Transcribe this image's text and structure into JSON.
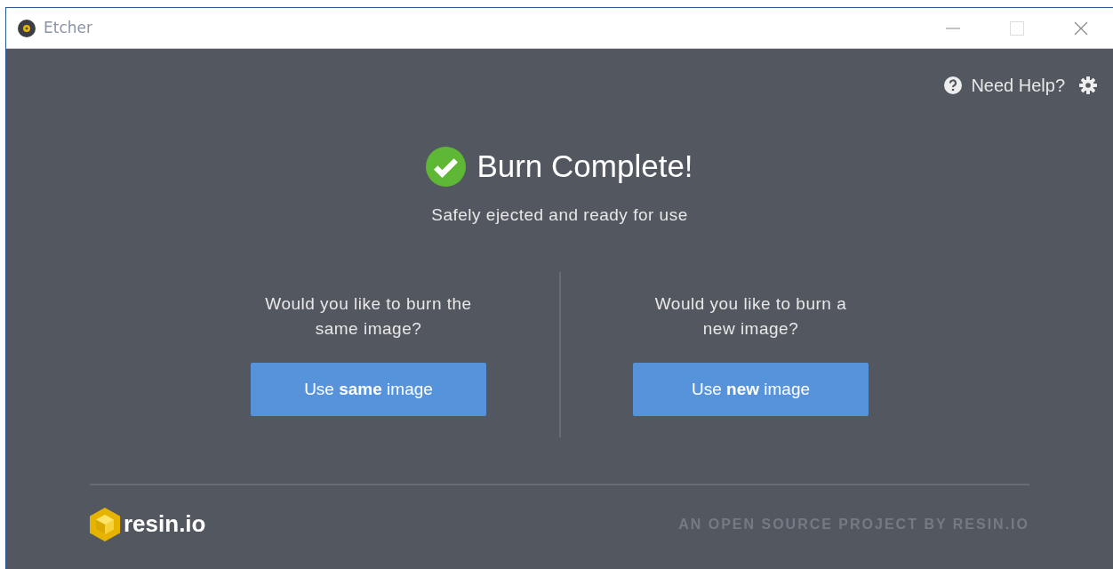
{
  "window": {
    "title": "Etcher"
  },
  "help": {
    "label": "Need Help?"
  },
  "result": {
    "title": "Burn Complete!",
    "subtitle": "Safely ejected and ready for use"
  },
  "options": [
    {
      "question": "Would you like to burn the same image?",
      "button": "Use **same** image"
    },
    {
      "question": "Would you like to burn a new image?",
      "button": "Use **new** image"
    }
  ],
  "footer": {
    "logo": "resin.io",
    "credit": "AN OPEN SOURCE PROJECT BY RESIN.IO"
  }
}
